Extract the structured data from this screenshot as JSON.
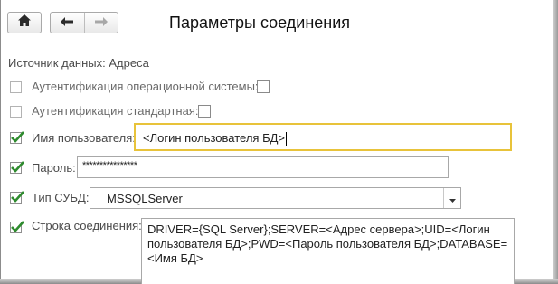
{
  "window": {
    "title": "Параметры соединения"
  },
  "toolbar": {
    "home_icon": "home-icon",
    "back_icon": "arrow-left-icon",
    "forward_icon": "arrow-right-icon"
  },
  "data_source": {
    "label": "Источник данных:",
    "value": "Адреса"
  },
  "os_auth": {
    "label": "Аутентификация операционной системы:",
    "enabled": false,
    "value": false
  },
  "std_auth": {
    "label": "Аутентификация стандартная:",
    "enabled": false,
    "value": false
  },
  "username": {
    "label": "Имя пользователя:",
    "enabled": true,
    "value": "<Логин пользователя БД>"
  },
  "password": {
    "label": "Пароль:",
    "enabled": true,
    "value": "****************"
  },
  "dbms_type": {
    "label": "Тип СУБД:",
    "enabled": true,
    "value": "MSSQLServer"
  },
  "connection_string": {
    "label": "Строка соединения:",
    "enabled": true,
    "value": "DRIVER={SQL Server};SERVER=<Адрес сервера>;UID=<Логин пользователя БД>;PWD=<Пароль пользователя БД>;DATABASE=<Имя БД>"
  },
  "colors": {
    "focus_border": "#e8c33a",
    "check_mark": "#2e8b2e"
  }
}
